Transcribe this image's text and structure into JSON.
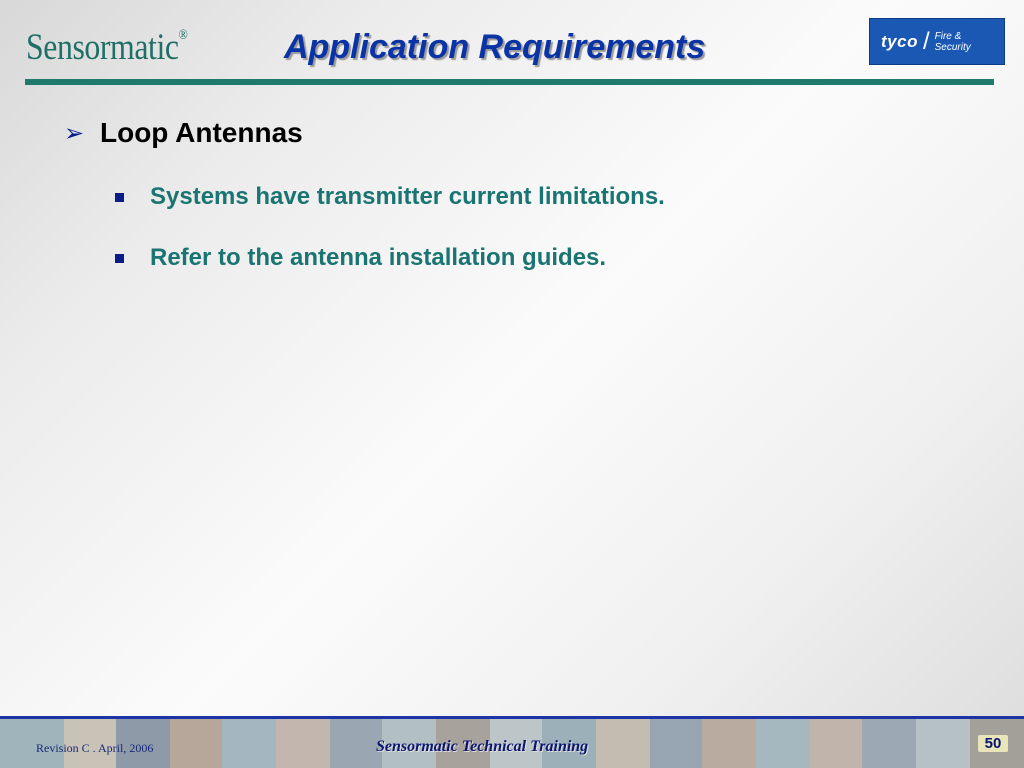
{
  "header": {
    "logo_left": "Sensormatic",
    "logo_left_mark": "®",
    "title": "Application Requirements",
    "logo_right": {
      "brand": "tyco",
      "sub": "Fire &\nSecurity"
    }
  },
  "content": {
    "heading": "Loop Antennas",
    "bullets": [
      "Systems have transmitter current limitations.",
      "Refer to the antenna installation guides."
    ]
  },
  "footer": {
    "revision": "Revision C . April, 2006",
    "center": "Sensormatic Technical Training",
    "page_number": "50"
  },
  "colors": {
    "title": "#0a33a5",
    "accent_teal": "#1f7a6c",
    "bullet_text": "#1a7471",
    "bullet_marker": "#0a1c86",
    "footer_border": "#1c34a4",
    "tyco_blue": "#1a58b3"
  },
  "icons": {
    "heading_marker": "arrow-bullet-icon",
    "bullet_marker": "square-bullet-icon"
  }
}
